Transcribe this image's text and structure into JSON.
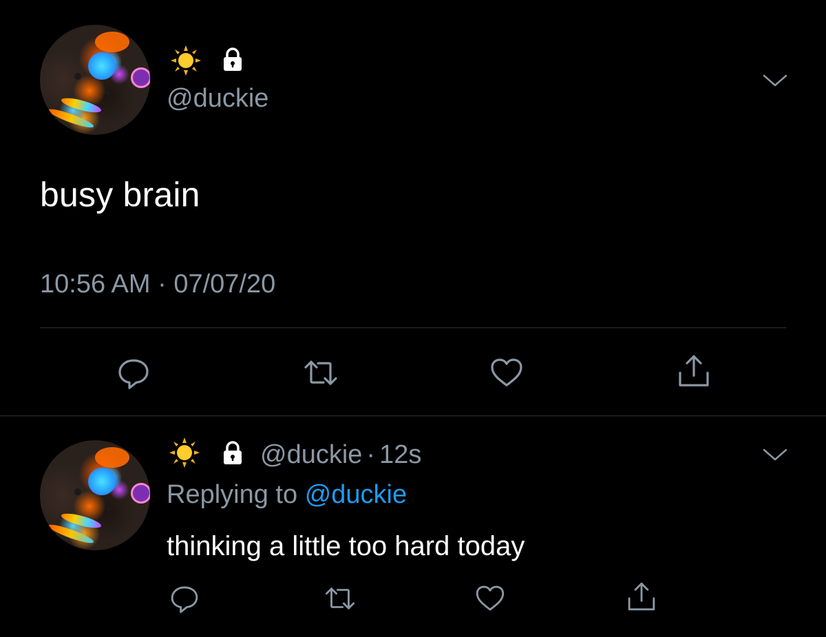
{
  "main_tweet": {
    "handle": "@duckie",
    "name_icons": [
      "sun-emoji",
      "lock-icon"
    ],
    "text": "busy brain",
    "timestamp": "10:56 AM · 07/07/20",
    "actions": [
      "reply-icon",
      "retweet-icon",
      "like-icon",
      "share-icon"
    ]
  },
  "reply_tweet": {
    "handle": "@duckie",
    "separator": "·",
    "time_ago": "12s",
    "replying_to_label": "Replying to",
    "replying_to_handle": "@duckie",
    "text": "thinking a little too hard today",
    "actions": [
      "reply-icon",
      "retweet-icon",
      "like-icon",
      "share-icon"
    ]
  },
  "colors": {
    "background": "#000000",
    "text": "#ffffff",
    "secondary_text": "#8b98a5",
    "mention": "#1d9bf0",
    "divider": "#2f3336"
  }
}
